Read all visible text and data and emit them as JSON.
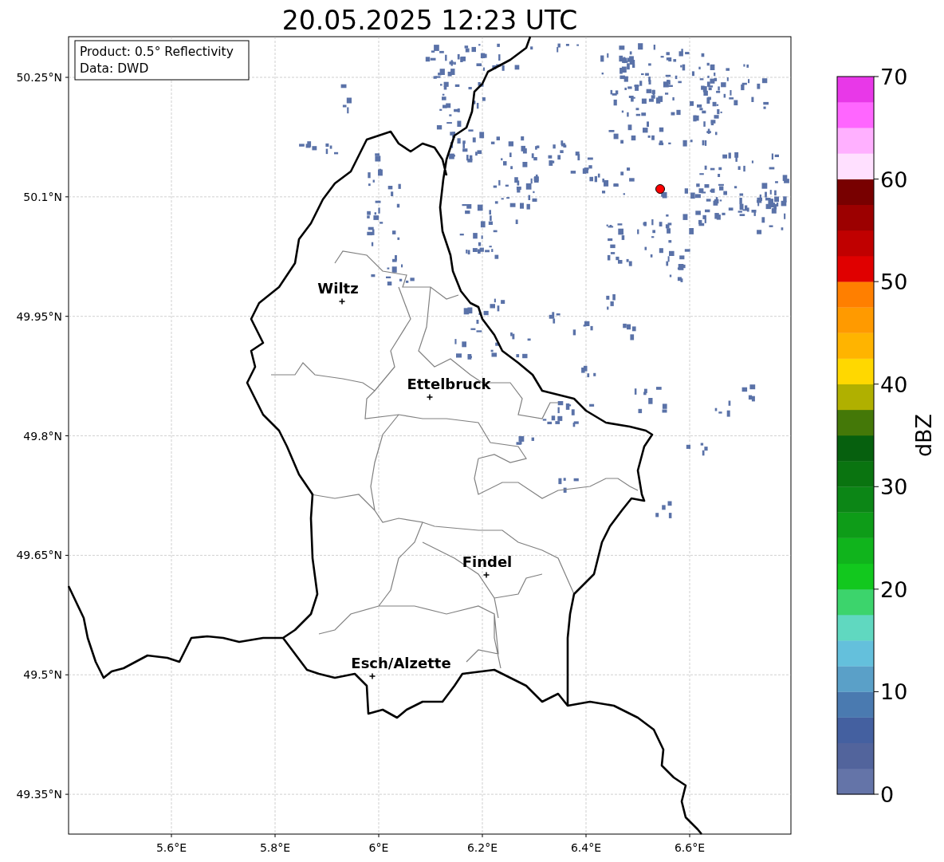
{
  "title": "20.05.2025 12:23 UTC",
  "info_box": {
    "lines": [
      "Product: 0.5° Reflectivity",
      "Data: DWD"
    ]
  },
  "map": {
    "y_axis_labels": [
      "50.25°N",
      "50.1°N",
      "49.95°N",
      "49.8°N",
      "49.65°N",
      "49.5°N",
      "49.35°N"
    ],
    "x_axis_labels": [
      "5.6°E",
      "5.8°E",
      "6°E",
      "6.2°E",
      "6.4°E",
      "6.6°E"
    ],
    "cities": [
      {
        "name": "Wiltz"
      },
      {
        "name": "Ettelbruck"
      },
      {
        "name": "Findel"
      },
      {
        "name": "Esch/Alzette"
      }
    ]
  },
  "colorbar": {
    "label": "dBZ",
    "ticks": [
      "70",
      "60",
      "50",
      "40",
      "30",
      "20",
      "10",
      "0"
    ],
    "segments": [
      {
        "color": "#6474a8"
      },
      {
        "color": "#52649c"
      },
      {
        "color": "#4460a0"
      },
      {
        "color": "#4a7ab0"
      },
      {
        "color": "#5aa0c8"
      },
      {
        "color": "#64c0dc"
      },
      {
        "color": "#60d8c0"
      },
      {
        "color": "#3cd46c"
      },
      {
        "color": "#12c81e"
      },
      {
        "color": "#10b41c"
      },
      {
        "color": "#0e9c18"
      },
      {
        "color": "#0c8616"
      },
      {
        "color": "#0a7410"
      },
      {
        "color": "#06600e"
      },
      {
        "color": "#447808"
      },
      {
        "color": "#b0b000"
      },
      {
        "color": "#ffd800"
      },
      {
        "color": "#ffb400"
      },
      {
        "color": "#ff9a00"
      },
      {
        "color": "#ff7f00"
      },
      {
        "color": "#e00000"
      },
      {
        "color": "#c00000"
      },
      {
        "color": "#9c0000"
      },
      {
        "color": "#780000"
      },
      {
        "color": "#ffe0ff"
      },
      {
        "color": "#ffb0ff"
      },
      {
        "color": "#ff66ff"
      },
      {
        "color": "#e838e8"
      }
    ]
  }
}
